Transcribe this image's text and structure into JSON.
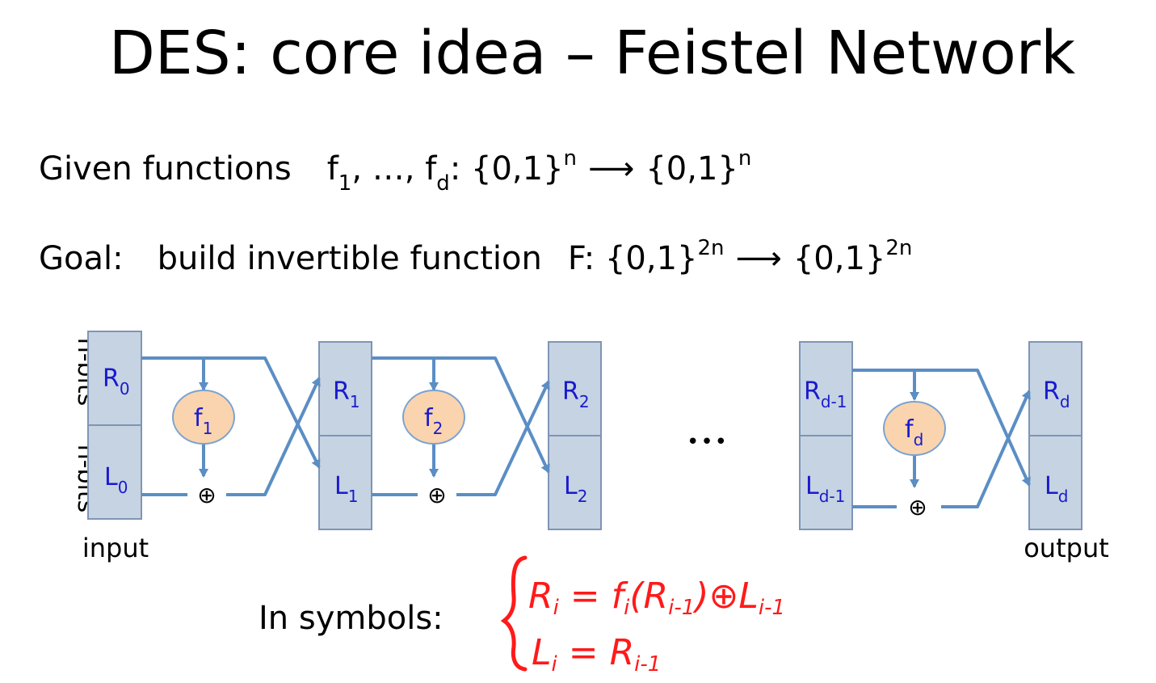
{
  "title": "DES:  core idea – Feistel Network",
  "given": {
    "label": "Given functions",
    "f_first": "f",
    "f_first_sub": "1",
    "ellipsis": ", …, ",
    "f_last": "f",
    "f_last_sub": "d",
    "domain": ":  {0,1}",
    "domain_sup": "n",
    "arrow": "⟶",
    "codomain": "{0,1}",
    "codomain_sup": "n"
  },
  "goal": {
    "label": "Goal:",
    "text": "build invertible function",
    "func": "F: {0,1}",
    "func_sup": "2n",
    "arrow": "⟶",
    "codomain": "{0,1}",
    "codomain_sup": "2n"
  },
  "diagram": {
    "side_label_top": "n-bits",
    "side_label_bottom": "n-bits",
    "input_label": "input",
    "output_label": "output",
    "dots": "•••",
    "xor_symbol": "⊕",
    "stages": [
      {
        "r": "R",
        "r_sub": "0",
        "l": "L",
        "l_sub": "0"
      },
      {
        "r": "R",
        "r_sub": "1",
        "l": "L",
        "l_sub": "1"
      },
      {
        "r": "R",
        "r_sub": "2",
        "l": "L",
        "l_sub": "2"
      },
      {
        "r": "R",
        "r_sub": "d-1",
        "l": "L",
        "l_sub": "d-1"
      },
      {
        "r": "R",
        "r_sub": "d",
        "l": "L",
        "l_sub": "d"
      }
    ],
    "functions": [
      {
        "name": "f",
        "sub": "1"
      },
      {
        "name": "f",
        "sub": "2"
      },
      {
        "name": "f",
        "sub": "d"
      }
    ]
  },
  "symbols": {
    "label": "In symbols:",
    "eq1_lhs": "R",
    "eq1_lhs_sub": "i",
    "eq1_mid": " = f",
    "eq1_f_sub": "i",
    "eq1_arg": "(R",
    "eq1_arg_sub": "i-1",
    "eq1_close": ")",
    "eq1_op": "⊕",
    "eq1_rhs": "L",
    "eq1_rhs_sub": "i-1",
    "eq2_lhs": "L",
    "eq2_lhs_sub": "i",
    "eq2_mid": " = R",
    "eq2_rhs_sub": "i-1"
  },
  "colors": {
    "box_fill": "#c5d3e3",
    "box_stroke": "#7f95b5",
    "arrow": "#5b8ec4",
    "register_text": "#1a1acc",
    "function_fill": "#fad4ae",
    "function_stroke": "#7aa3d0",
    "handwriting": "#ff1a1a"
  }
}
